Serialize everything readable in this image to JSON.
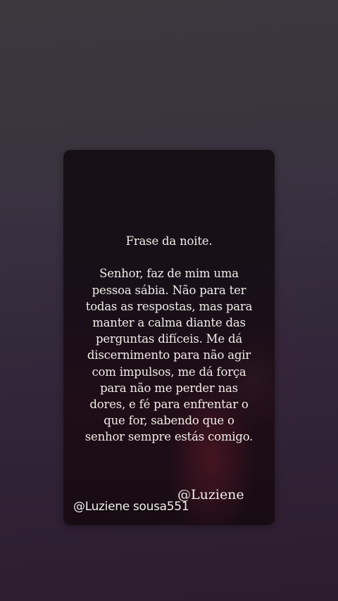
{
  "quote": {
    "title": "Frase da noite.",
    "lines": [
      "Senhor, faz de mim uma",
      "pessoa sábia. Não para ter",
      "todas as respostas, mas para",
      "manter a calma diante das",
      "perguntas difíceis. Me dá",
      "discernimento para não agir",
      "com impulsos, me dá força",
      "para não me perder nas",
      "dores, e fé para enfrentar o",
      "que for, sabendo que o",
      "senhor sempre estás comigo."
    ]
  },
  "signatures": {
    "author_handle": "@Luziene",
    "watermark_handle": "@Luziene sousa551"
  }
}
